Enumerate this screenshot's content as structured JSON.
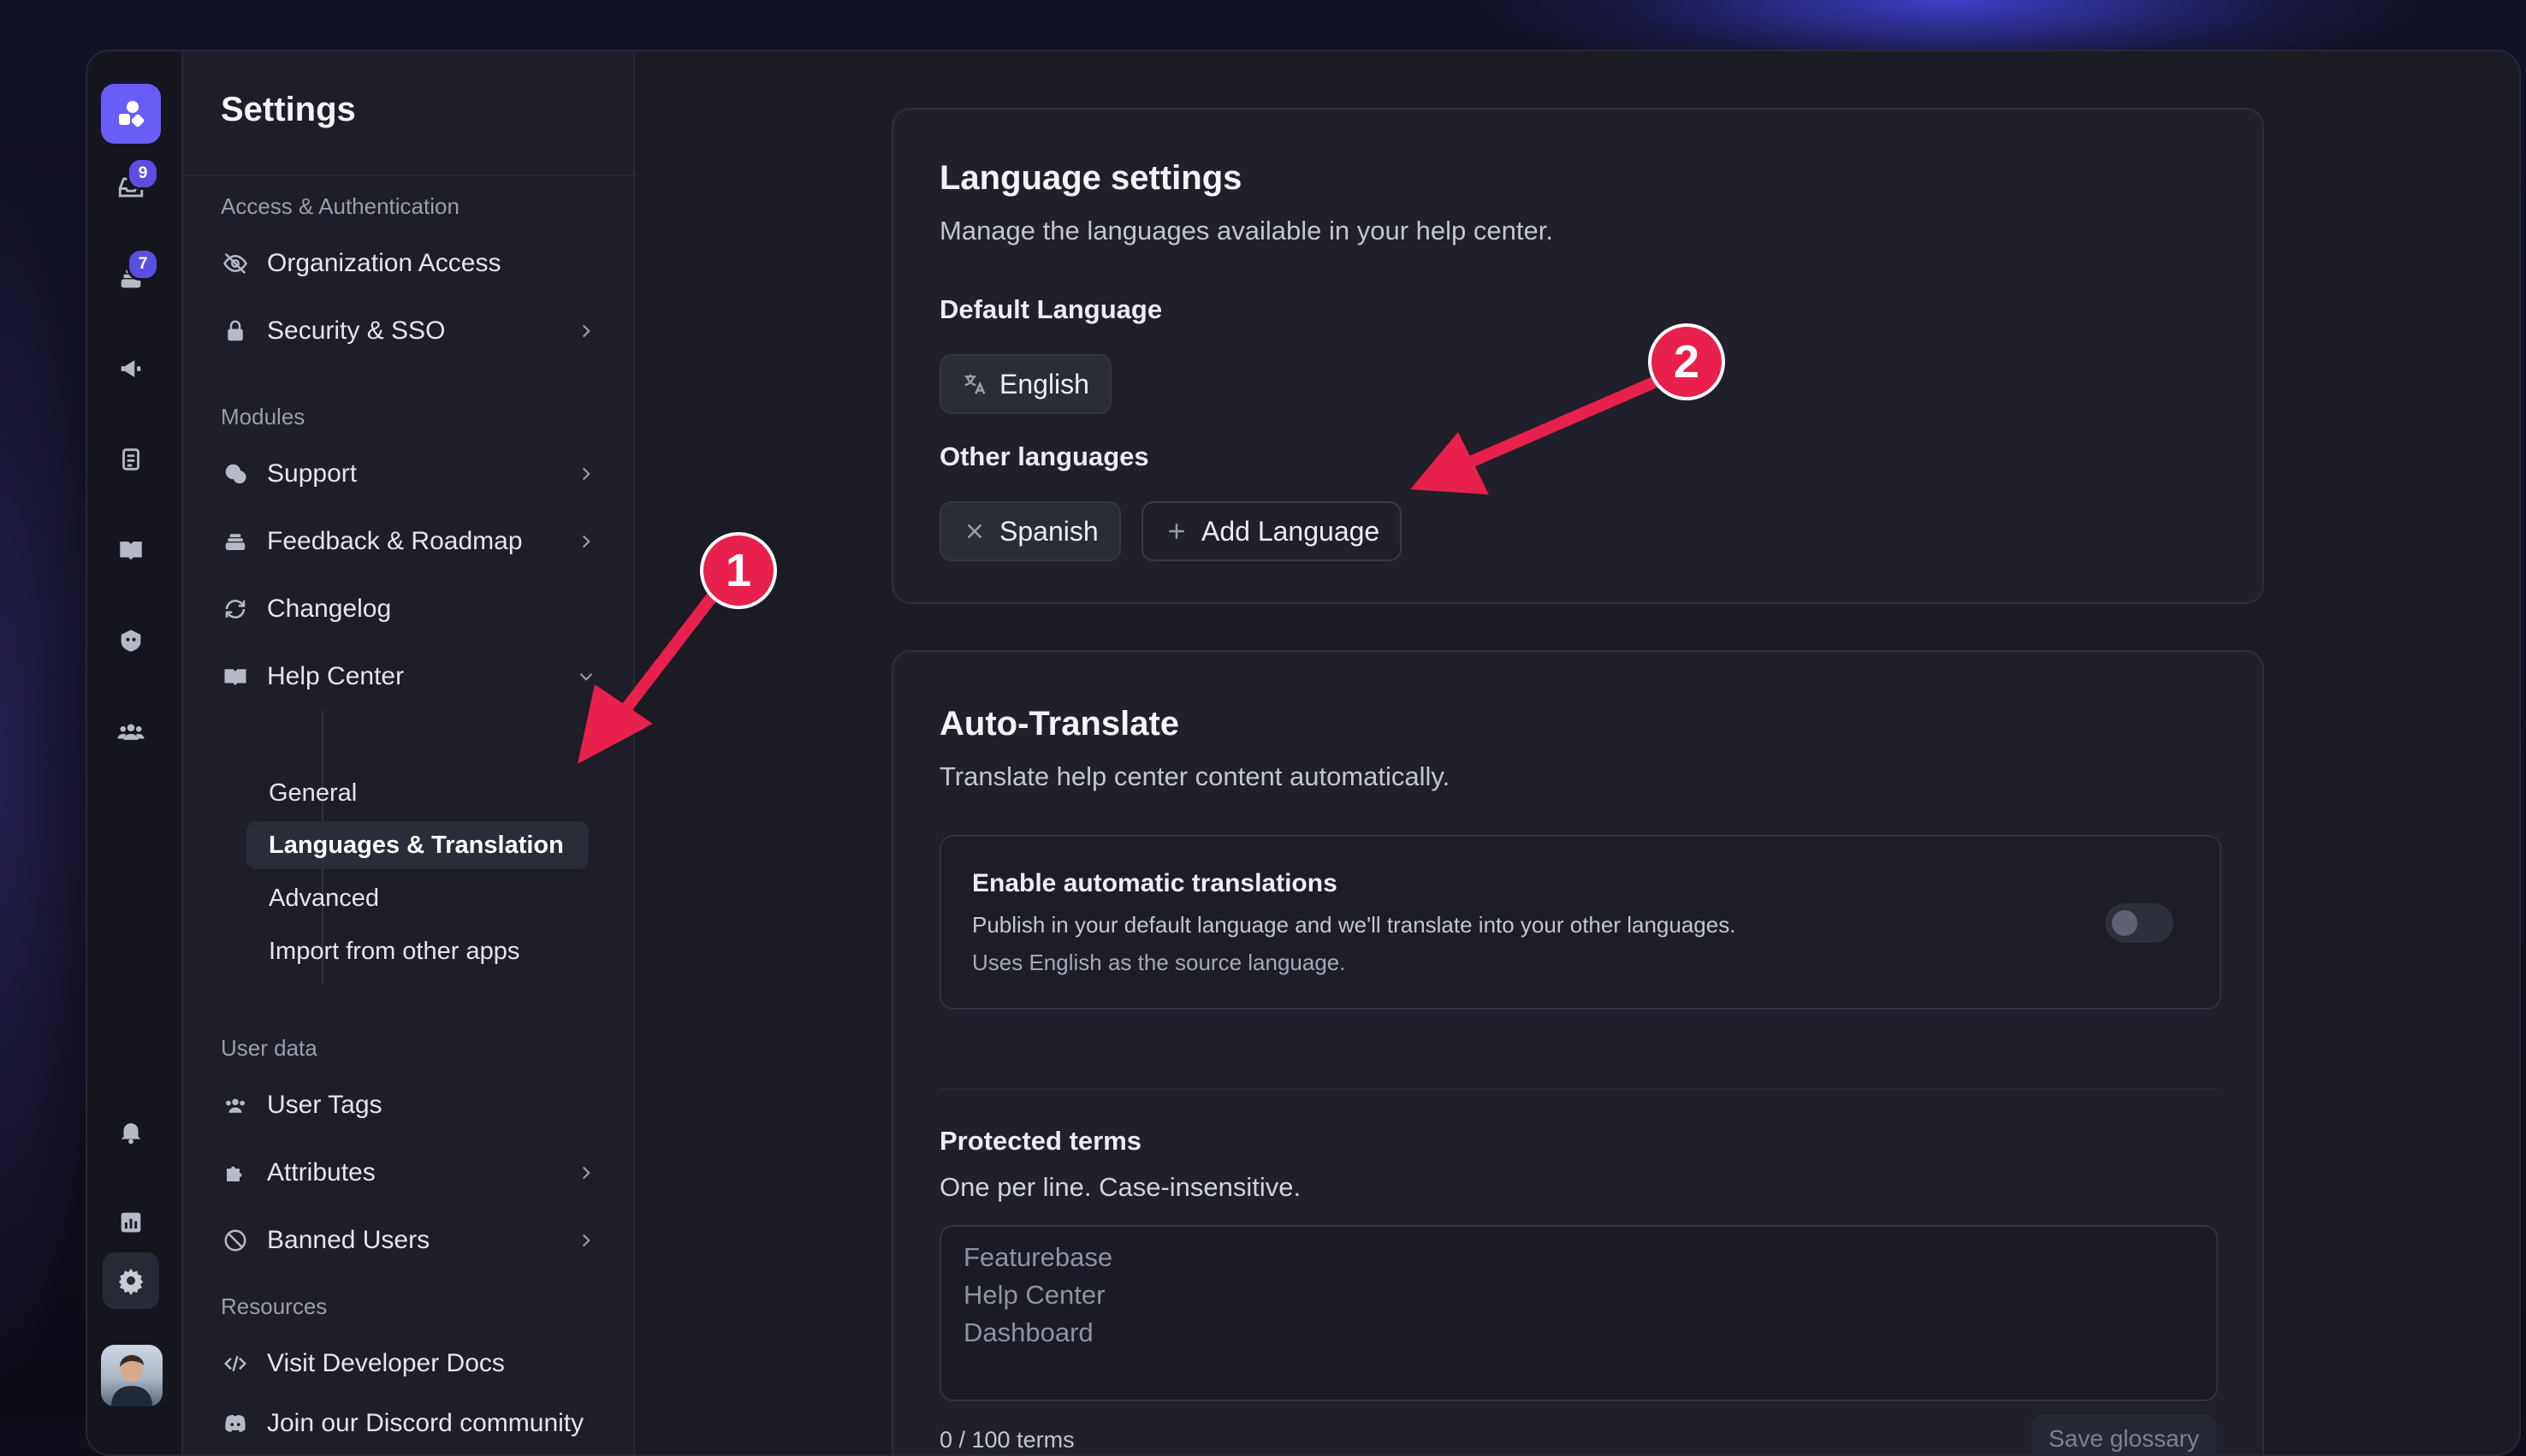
{
  "sidebar": {
    "title": "Settings",
    "sections": {
      "access": "Access & Authentication",
      "modules": "Modules",
      "user_data": "User data",
      "resources": "Resources"
    },
    "items": {
      "org_access": "Organization Access",
      "security": "Security & SSO",
      "support": "Support",
      "feedback": "Feedback & Roadmap",
      "changelog": "Changelog",
      "help_center": "Help Center",
      "user_tags": "User Tags",
      "attributes": "Attributes",
      "banned": "Banned Users",
      "dev_docs": "Visit Developer Docs",
      "discord": "Join our Discord community"
    },
    "help_center_sub": {
      "general": "General",
      "languages": "Languages & Translation",
      "advanced": "Advanced",
      "import": "Import from other apps"
    }
  },
  "rail": {
    "badges": {
      "inbox": "9",
      "feedback": "7"
    },
    "icons": [
      "logo-icon",
      "inbox-icon",
      "layers-icon",
      "megaphone-icon",
      "docs-icon",
      "book-icon",
      "bot-icon",
      "users-icon",
      "bell-icon",
      "chart-icon",
      "gear-icon"
    ]
  },
  "language_card": {
    "title": "Language settings",
    "subtitle": "Manage the languages available in your help center.",
    "default_label": "Default Language",
    "default_value": "English",
    "other_label": "Other languages",
    "other_languages": [
      "Spanish"
    ],
    "add_button": "Add Language"
  },
  "auto_translate": {
    "title": "Auto-Translate",
    "subtitle": "Translate help center content automatically.",
    "toggle_title": "Enable automatic translations",
    "toggle_desc": "Publish in your default language and we'll translate into your other languages.",
    "toggle_note": "Uses English as the source language.",
    "toggle_on": false,
    "protected_title": "Protected terms",
    "protected_desc": "One per line. Case-insensitive.",
    "placeholder_lines": [
      "Featurebase",
      "Help Center",
      "Dashboard"
    ],
    "count": "0 / 100 terms",
    "save_button": "Save glossary"
  },
  "callouts": [
    "1",
    "2"
  ],
  "colors": {
    "accent": "#6a5cf6",
    "callout": "#e8204c"
  }
}
